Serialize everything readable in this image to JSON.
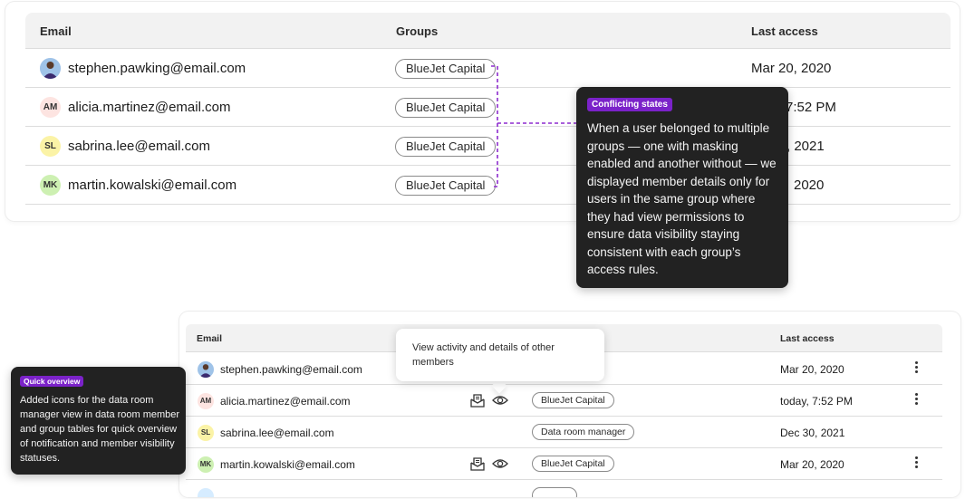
{
  "table1": {
    "headers": {
      "email": "Email",
      "groups": "Groups",
      "last_access": "Last access"
    },
    "rows": [
      {
        "email": "stephen.pawking@email.com",
        "avatar": "",
        "avatar_color": "#c9d8f2",
        "group": "BlueJet Capital",
        "last_access": "Mar 20, 2020"
      },
      {
        "email": "alicia.martinez@email.com",
        "avatar": "AM",
        "avatar_color": "#fde4e1",
        "group": "BlueJet Capital",
        "last_access": "7:52 PM"
      },
      {
        "email": "sabrina.lee@email.com",
        "avatar": "SL",
        "avatar_color": "#fbf3a6",
        "group": "BlueJet Capital",
        "last_access": ", 2021"
      },
      {
        "email": "martin.kowalski@email.com",
        "avatar": "MK",
        "avatar_color": "#cdf0b2",
        "group": "BlueJet Capital",
        "last_access": "2020"
      }
    ]
  },
  "tooltip_conflict": {
    "tag": "Conflicting states",
    "body": "When a user belonged to multiple groups — one with masking enabled and another without — we displayed member details only for users in the same group where they had view permissions to ensure data visibility staying consistent with each group’s access rules."
  },
  "table2": {
    "headers": {
      "email": "Email",
      "last_access": "Last access"
    },
    "rows": [
      {
        "email": "stephen.pawking@email.com",
        "avatar": "",
        "avatar_color": "#c9d8f2",
        "group": "",
        "last_access": "Mar 20, 2020",
        "icons": false
      },
      {
        "email": "alicia.martinez@email.com",
        "avatar": "AM",
        "avatar_color": "#fde4e1",
        "group": "BlueJet Capital",
        "last_access": "today, 7:52 PM",
        "icons": true
      },
      {
        "email": "sabrina.lee@email.com",
        "avatar": "SL",
        "avatar_color": "#fbf3a6",
        "group": "Data room manager",
        "last_access": "Dec 30, 2021",
        "icons": false
      },
      {
        "email": "martin.kowalski@email.com",
        "avatar": "MK",
        "avatar_color": "#cdf0b2",
        "group": "BlueJet Capital",
        "last_access": "Mar 20, 2020",
        "icons": true
      }
    ]
  },
  "tooltip_view": {
    "text": "View activity and details of other members"
  },
  "tooltip_quick": {
    "tag": "Quick overview",
    "body": "Added icons for the data room manager view in data room member and group tables for quick overview of notification and member visibility statuses."
  },
  "colors": {
    "accent_purple": "#7b22c9",
    "tooltip_dark": "#222222",
    "chip_border": "#8a8a8a"
  },
  "icons": [
    "notification-icon",
    "eye-icon",
    "more-vertical-icon",
    "user-photo-icon"
  ]
}
